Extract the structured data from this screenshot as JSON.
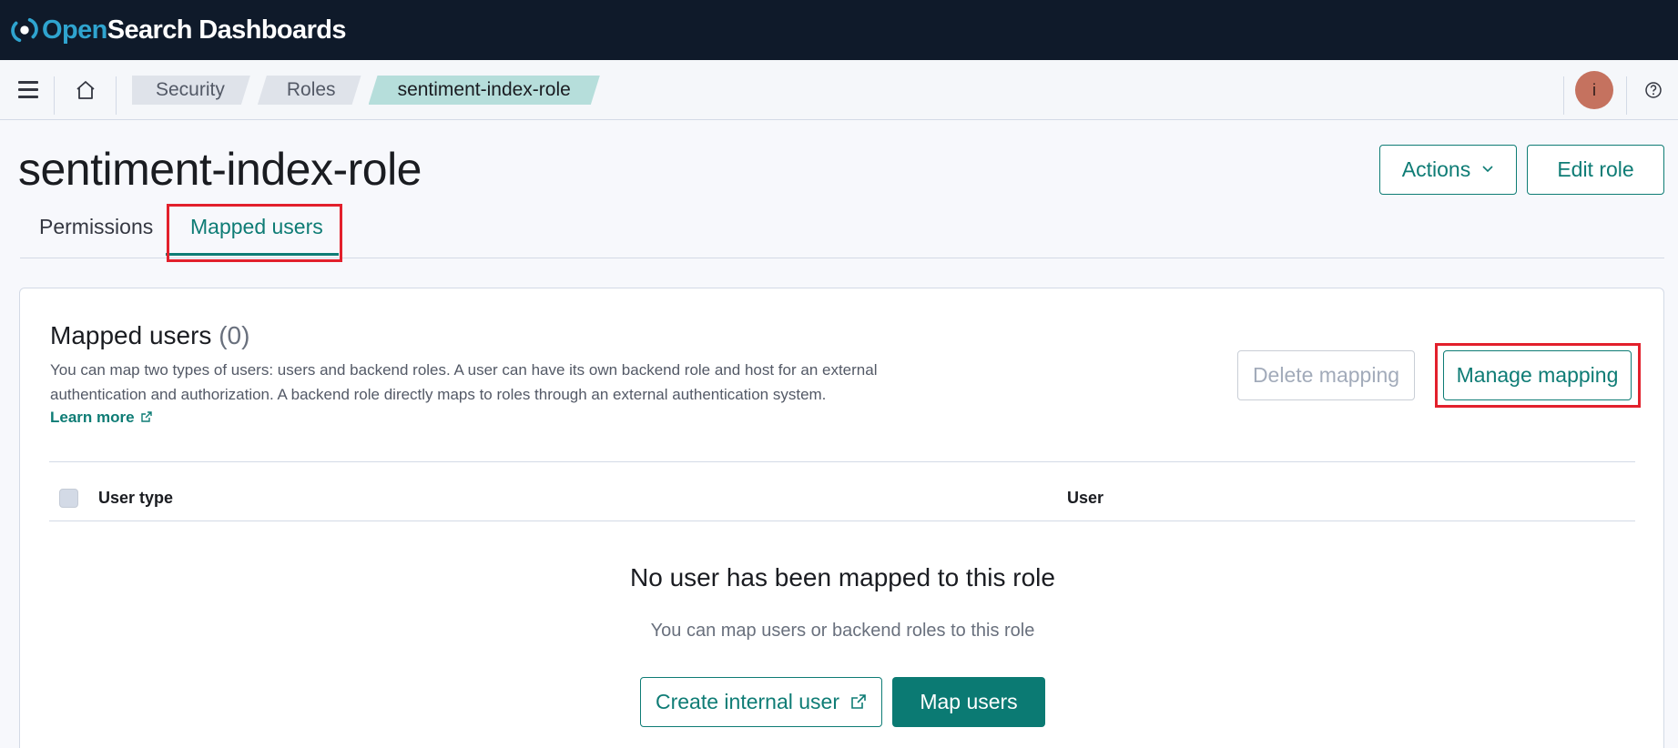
{
  "header": {
    "logo_open": "Open",
    "logo_rest": "Search Dashboards"
  },
  "navbar": {
    "breadcrumbs": [
      "Security",
      "Roles",
      "sentiment-index-role"
    ],
    "avatar_initial": "i",
    "icons": [
      "menu-icon",
      "home-icon",
      "help-icon"
    ]
  },
  "page": {
    "title": "sentiment-index-role",
    "actions_label": "Actions",
    "edit_label": "Edit role"
  },
  "tabs": [
    {
      "label": "Permissions",
      "active": false
    },
    {
      "label": "Mapped users",
      "active": true
    }
  ],
  "panel": {
    "title": "Mapped users",
    "count": "(0)",
    "description_line1": "You can map two types of users: users and backend roles. A user can have its own backend role and host for an external",
    "description_line2": "authentication and authorization. A backend role directly maps to roles through an external authentication system.",
    "learn_more": "Learn more",
    "delete_label": "Delete mapping",
    "manage_label": "Manage mapping",
    "columns": [
      "User type",
      "User"
    ],
    "empty_title": "No user has been mapped to this role",
    "empty_subtitle": "You can map users or backend roles to this role",
    "create_label": "Create internal user",
    "map_label": "Map users"
  },
  "colors": {
    "accent": "#0e7c75",
    "header_bg": "#0f1a2a",
    "highlight": "#e2202c"
  }
}
